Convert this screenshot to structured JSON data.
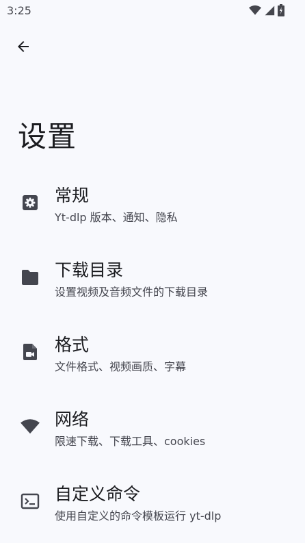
{
  "status_bar": {
    "time": "3:25"
  },
  "header": {
    "title": "设置"
  },
  "settings": {
    "items": [
      {
        "title": "常规",
        "description": "Yt-dlp 版本、通知、隐私",
        "icon": "gear-icon"
      },
      {
        "title": "下载目录",
        "description": "设置视频及音频文件的下载目录",
        "icon": "folder-icon"
      },
      {
        "title": "格式",
        "description": "文件格式、视频画质、字幕",
        "icon": "video-file-icon"
      },
      {
        "title": "网络",
        "description": "限速下载、下载工具、cookies",
        "icon": "wifi-icon"
      },
      {
        "title": "自定义命令",
        "description": "使用自定义的命令模板运行 yt-dlp",
        "icon": "terminal-icon"
      }
    ]
  },
  "colors": {
    "background": "#f8f9fd",
    "icon": "#44464f",
    "text_primary": "#1b1c20",
    "text_secondary": "#45464f"
  }
}
